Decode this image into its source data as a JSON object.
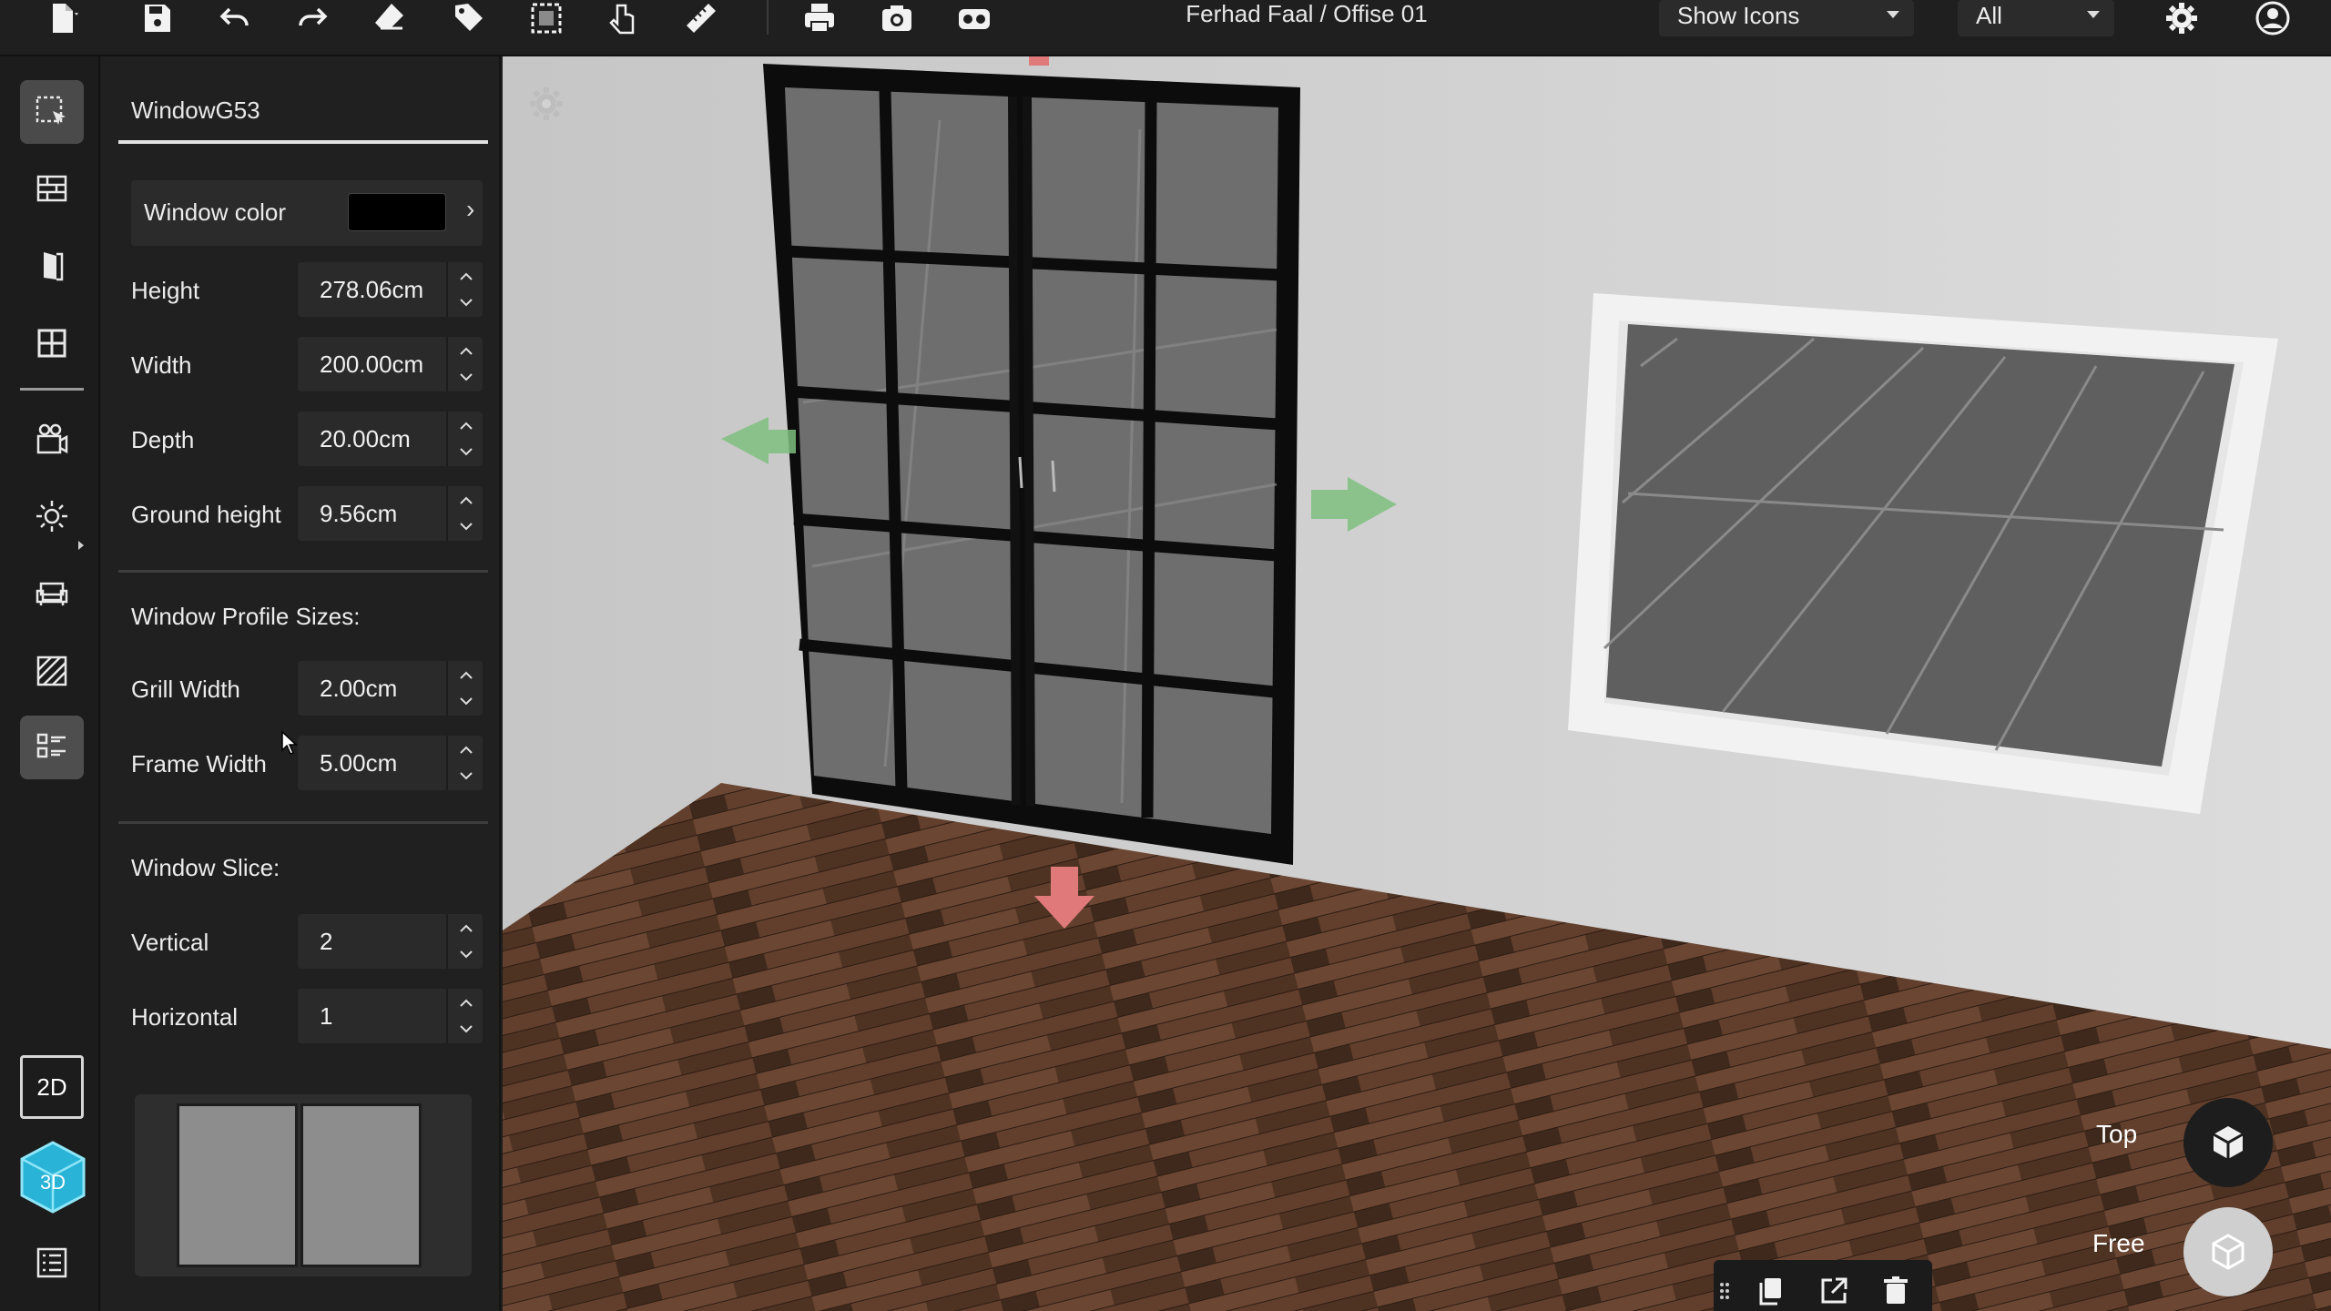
{
  "toolbar": {
    "items": [
      {
        "icon": "new-file-icon",
        "has_menu": true
      },
      {
        "icon": "save-icon"
      },
      {
        "icon": "undo-icon"
      },
      {
        "icon": "redo-icon"
      },
      {
        "icon": "eraser-icon"
      },
      {
        "icon": "tag-icon"
      },
      {
        "icon": "frame-select-icon"
      },
      {
        "icon": "hand-pointer-icon"
      },
      {
        "icon": "ruler-icon",
        "has_menu": true
      },
      {
        "icon": "print-icon"
      },
      {
        "icon": "camera-icon"
      },
      {
        "icon": "vr-headset-icon"
      }
    ],
    "project_title": "Ferhad Faal / Offise 01",
    "icons_dropdown": "Show Icons",
    "filter_dropdown": "All"
  },
  "rail": {
    "items": [
      "select-icon",
      "wall-icon",
      "door-icon",
      "window-icon",
      "camera-icon",
      "light-icon",
      "furniture-icon",
      "texture-icon",
      "properties-list-icon",
      "list-icon"
    ],
    "active": "properties-list-icon",
    "mode_2d": "2D",
    "mode_3d": "3D"
  },
  "panel": {
    "object_name": "WindowG53",
    "window_color_label": "Window color",
    "window_color": "#000000",
    "fields": {
      "height": {
        "label": "Height",
        "value": "278.06cm"
      },
      "width": {
        "label": "Width",
        "value": "200.00cm"
      },
      "depth": {
        "label": "Depth",
        "value": "20.00cm"
      },
      "ground_height": {
        "label": "Ground height",
        "value": "9.56cm"
      }
    },
    "profile_title": "Window Profile Sizes:",
    "profile": {
      "grill_width": {
        "label": "Grill Width",
        "value": "2.00cm"
      },
      "frame_width": {
        "label": "Frame Width",
        "value": "5.00cm"
      }
    },
    "slice_title": "Window Slice:",
    "slice": {
      "vertical": {
        "label": "Vertical",
        "value": "2"
      },
      "horizontal": {
        "label": "Horizontal",
        "value": "1"
      }
    }
  },
  "viewport": {
    "views": {
      "top": "Top",
      "free": "Free"
    },
    "selection_tools": [
      "drag-handle-icon",
      "copy-icon",
      "open-external-icon",
      "trash-icon"
    ],
    "colors": {
      "wall": "#cfcfcf",
      "floor": "#5a3b29",
      "frame": "#111111",
      "glass": "#6e6e6e",
      "arrow_green": "#7fbf7f",
      "arrow_red": "#e07a7a"
    }
  }
}
